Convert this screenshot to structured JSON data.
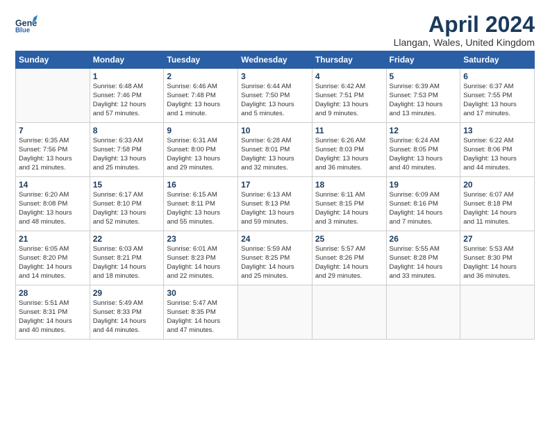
{
  "header": {
    "logo_line1": "General",
    "logo_line2": "Blue",
    "month_title": "April 2024",
    "location": "Llangan, Wales, United Kingdom"
  },
  "weekdays": [
    "Sunday",
    "Monday",
    "Tuesday",
    "Wednesday",
    "Thursday",
    "Friday",
    "Saturday"
  ],
  "weeks": [
    [
      {
        "day": "",
        "info": ""
      },
      {
        "day": "1",
        "info": "Sunrise: 6:48 AM\nSunset: 7:46 PM\nDaylight: 12 hours\nand 57 minutes."
      },
      {
        "day": "2",
        "info": "Sunrise: 6:46 AM\nSunset: 7:48 PM\nDaylight: 13 hours\nand 1 minute."
      },
      {
        "day": "3",
        "info": "Sunrise: 6:44 AM\nSunset: 7:50 PM\nDaylight: 13 hours\nand 5 minutes."
      },
      {
        "day": "4",
        "info": "Sunrise: 6:42 AM\nSunset: 7:51 PM\nDaylight: 13 hours\nand 9 minutes."
      },
      {
        "day": "5",
        "info": "Sunrise: 6:39 AM\nSunset: 7:53 PM\nDaylight: 13 hours\nand 13 minutes."
      },
      {
        "day": "6",
        "info": "Sunrise: 6:37 AM\nSunset: 7:55 PM\nDaylight: 13 hours\nand 17 minutes."
      }
    ],
    [
      {
        "day": "7",
        "info": "Sunrise: 6:35 AM\nSunset: 7:56 PM\nDaylight: 13 hours\nand 21 minutes."
      },
      {
        "day": "8",
        "info": "Sunrise: 6:33 AM\nSunset: 7:58 PM\nDaylight: 13 hours\nand 25 minutes."
      },
      {
        "day": "9",
        "info": "Sunrise: 6:31 AM\nSunset: 8:00 PM\nDaylight: 13 hours\nand 29 minutes."
      },
      {
        "day": "10",
        "info": "Sunrise: 6:28 AM\nSunset: 8:01 PM\nDaylight: 13 hours\nand 32 minutes."
      },
      {
        "day": "11",
        "info": "Sunrise: 6:26 AM\nSunset: 8:03 PM\nDaylight: 13 hours\nand 36 minutes."
      },
      {
        "day": "12",
        "info": "Sunrise: 6:24 AM\nSunset: 8:05 PM\nDaylight: 13 hours\nand 40 minutes."
      },
      {
        "day": "13",
        "info": "Sunrise: 6:22 AM\nSunset: 8:06 PM\nDaylight: 13 hours\nand 44 minutes."
      }
    ],
    [
      {
        "day": "14",
        "info": "Sunrise: 6:20 AM\nSunset: 8:08 PM\nDaylight: 13 hours\nand 48 minutes."
      },
      {
        "day": "15",
        "info": "Sunrise: 6:17 AM\nSunset: 8:10 PM\nDaylight: 13 hours\nand 52 minutes."
      },
      {
        "day": "16",
        "info": "Sunrise: 6:15 AM\nSunset: 8:11 PM\nDaylight: 13 hours\nand 55 minutes."
      },
      {
        "day": "17",
        "info": "Sunrise: 6:13 AM\nSunset: 8:13 PM\nDaylight: 13 hours\nand 59 minutes."
      },
      {
        "day": "18",
        "info": "Sunrise: 6:11 AM\nSunset: 8:15 PM\nDaylight: 14 hours\nand 3 minutes."
      },
      {
        "day": "19",
        "info": "Sunrise: 6:09 AM\nSunset: 8:16 PM\nDaylight: 14 hours\nand 7 minutes."
      },
      {
        "day": "20",
        "info": "Sunrise: 6:07 AM\nSunset: 8:18 PM\nDaylight: 14 hours\nand 11 minutes."
      }
    ],
    [
      {
        "day": "21",
        "info": "Sunrise: 6:05 AM\nSunset: 8:20 PM\nDaylight: 14 hours\nand 14 minutes."
      },
      {
        "day": "22",
        "info": "Sunrise: 6:03 AM\nSunset: 8:21 PM\nDaylight: 14 hours\nand 18 minutes."
      },
      {
        "day": "23",
        "info": "Sunrise: 6:01 AM\nSunset: 8:23 PM\nDaylight: 14 hours\nand 22 minutes."
      },
      {
        "day": "24",
        "info": "Sunrise: 5:59 AM\nSunset: 8:25 PM\nDaylight: 14 hours\nand 25 minutes."
      },
      {
        "day": "25",
        "info": "Sunrise: 5:57 AM\nSunset: 8:26 PM\nDaylight: 14 hours\nand 29 minutes."
      },
      {
        "day": "26",
        "info": "Sunrise: 5:55 AM\nSunset: 8:28 PM\nDaylight: 14 hours\nand 33 minutes."
      },
      {
        "day": "27",
        "info": "Sunrise: 5:53 AM\nSunset: 8:30 PM\nDaylight: 14 hours\nand 36 minutes."
      }
    ],
    [
      {
        "day": "28",
        "info": "Sunrise: 5:51 AM\nSunset: 8:31 PM\nDaylight: 14 hours\nand 40 minutes."
      },
      {
        "day": "29",
        "info": "Sunrise: 5:49 AM\nSunset: 8:33 PM\nDaylight: 14 hours\nand 44 minutes."
      },
      {
        "day": "30",
        "info": "Sunrise: 5:47 AM\nSunset: 8:35 PM\nDaylight: 14 hours\nand 47 minutes."
      },
      {
        "day": "",
        "info": ""
      },
      {
        "day": "",
        "info": ""
      },
      {
        "day": "",
        "info": ""
      },
      {
        "day": "",
        "info": ""
      }
    ]
  ]
}
